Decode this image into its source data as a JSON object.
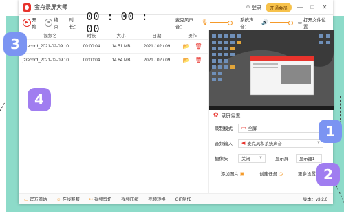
{
  "app": {
    "title": "金舟录屏大师",
    "login": "登录",
    "vip": "开通会员",
    "minimize": "—",
    "maximize": "□",
    "close": "✕"
  },
  "toolbar": {
    "start": "开始",
    "stop": "结束",
    "duration_label": "时长：",
    "timer": "00 : 00 : 00",
    "mic_label": "麦克风声音：",
    "sys_label": "系统声音：",
    "open_folder": "打开文件位置"
  },
  "table": {
    "headers": [
      "视频名",
      "时长",
      "大小",
      "日期",
      "操作"
    ],
    "rows": [
      {
        "name": "jzrecord_2021-02-09 10...",
        "duration": "00:00:04",
        "size": "14.51 MB",
        "date": "2021 / 02 / 09"
      },
      {
        "name": "jzrecord_2021-02-09 10...",
        "duration": "00:00:04",
        "size": "14.64 MB",
        "date": "2021 / 02 / 09"
      }
    ]
  },
  "settings": {
    "title": "录屏设置",
    "mode_label": "录制模式",
    "mode_value": "全屏",
    "audio_label": "音频输入",
    "audio_value": "麦克风和系统声音",
    "camera_label": "摄像头",
    "camera_value": "关闭",
    "display_label": "显示屏",
    "display_value": "显示器1",
    "add_image": "添加图片",
    "create_task": "创建任务",
    "more_settings": "更多设置"
  },
  "statusbar": {
    "site": "官方网站",
    "service": "在线客服",
    "cut": "视频剪切",
    "compress": "视频压缩",
    "convert": "视频转换",
    "gif": "GIF制作",
    "version": "版本：v3.2.6"
  },
  "badges": {
    "b1": "1",
    "b2": "2",
    "b3": "3",
    "b4": "4"
  },
  "colors": {
    "accent": "#e8332c",
    "orange": "#f59a2a",
    "mint": "#8ddbc9",
    "badge_blue": "#7b94f2",
    "badge_purple": "#a07df0"
  }
}
